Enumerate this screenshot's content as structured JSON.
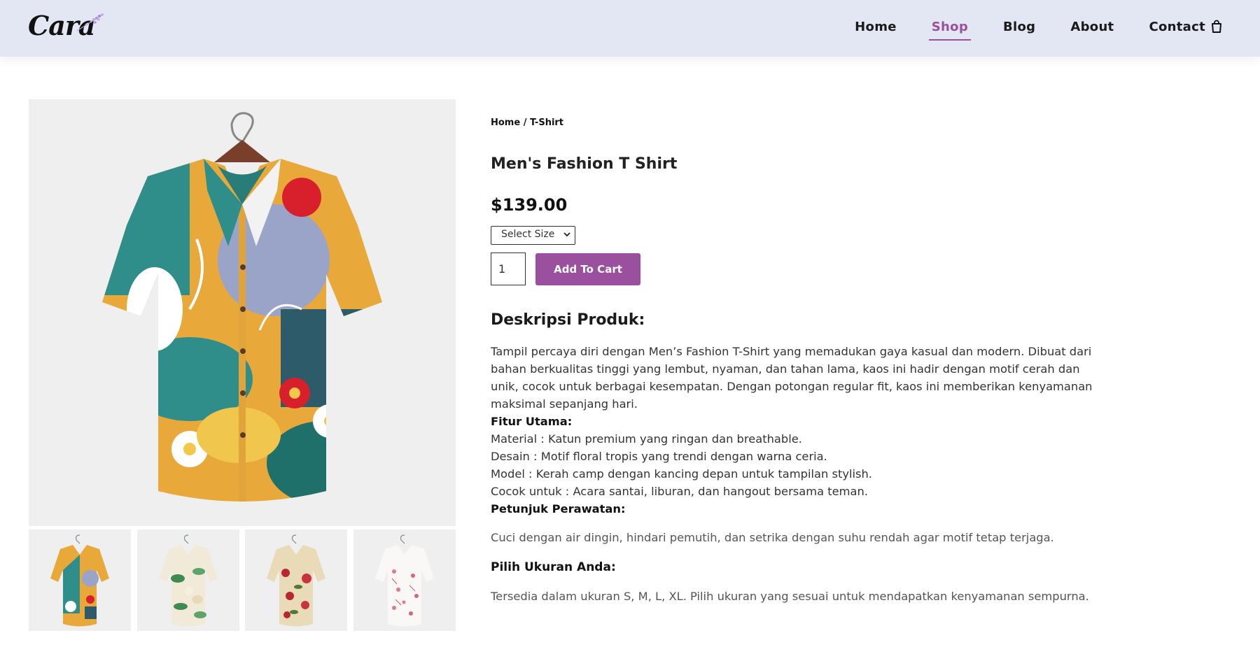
{
  "brand": {
    "logo_text": "Cara"
  },
  "nav": {
    "items": [
      {
        "label": "Home",
        "active": false
      },
      {
        "label": "Shop",
        "active": true
      },
      {
        "label": "Blog",
        "active": false
      },
      {
        "label": "About",
        "active": false
      },
      {
        "label": "Contact",
        "active": false
      }
    ],
    "cart_icon": "shopping-bag-icon"
  },
  "colors": {
    "header_bg": "#e3e6f3",
    "accent": "#9b4f9f",
    "image_bg": "#efefef"
  },
  "product": {
    "breadcrumb": "Home / T-Shirt",
    "title": "Men's Fashion T Shirt",
    "price": "$139.00",
    "size_select": {
      "selected": "Select Size"
    },
    "quantity": "1",
    "add_to_cart": "Add To Cart",
    "description_title": "Deskripsi Produk:",
    "description": "Tampil percaya diri dengan Men’s Fashion T-Shirt yang memadukan gaya kasual dan modern. Dibuat dari bahan berkualitas tinggi yang lembut, nyaman, dan tahan lama, kaos ini hadir dengan motif cerah dan unik, cocok untuk berbagai kesempatan. Dengan potongan regular fit, kaos ini memberikan kenyamanan maksimal sepanjang hari.",
    "features_title": "Fitur Utama:",
    "features": [
      "Material : Katun premium yang ringan dan breathable.",
      "Desain : Motif floral tropis yang trendi dengan warna ceria.",
      "Model : Kerah camp dengan kancing depan untuk tampilan stylish.",
      "Cocok untuk : Acara santai, liburan, dan hangout bersama teman."
    ],
    "care_title": "Petunjuk Perawatan:",
    "care_text": "Cuci dengan air dingin, hindari pemutih, dan setrika dengan suhu rendah agar motif tetap terjaga.",
    "size_title": "Pilih Ukuran Anda:",
    "size_text": "Tersedia dalam ukuran S, M, L, XL. Pilih ukuran yang sesuai untuk mendapatkan kenyamanan sempurna."
  },
  "gallery": {
    "thumbnails": [
      {
        "name": "colorful-abstract-shirt"
      },
      {
        "name": "green-floral-shirt"
      },
      {
        "name": "red-floral-shirt"
      },
      {
        "name": "pink-floral-shirt"
      }
    ]
  }
}
